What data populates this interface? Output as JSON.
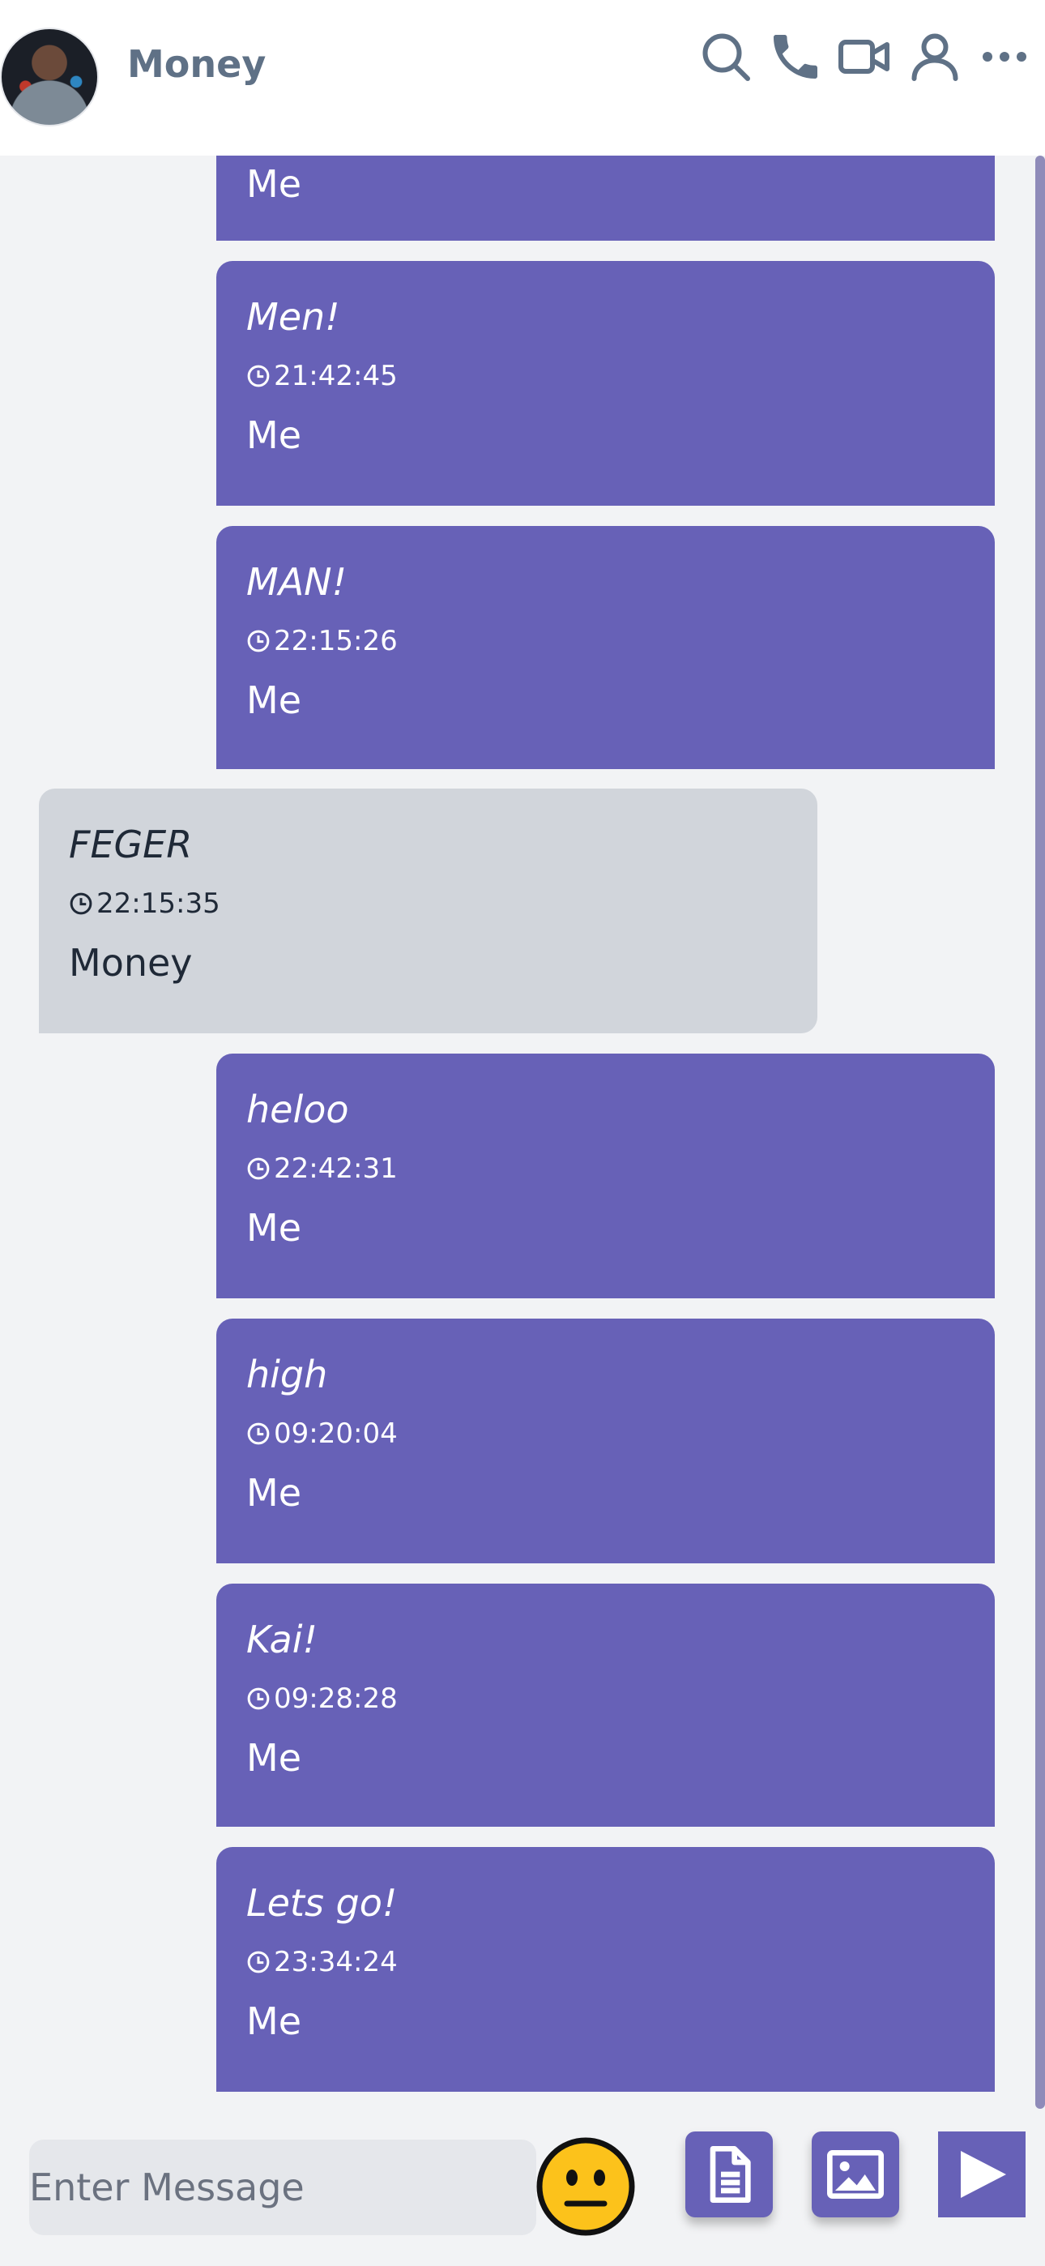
{
  "header": {
    "contact_name": "Money",
    "icons": [
      "search-icon",
      "phone-icon",
      "video-icon",
      "user-icon",
      "more-icon"
    ]
  },
  "messages": [
    {
      "text": "",
      "time": "",
      "sender": "Me",
      "from_me": true
    },
    {
      "text": "Men!",
      "time": "21:42:45",
      "sender": "Me",
      "from_me": true
    },
    {
      "text": "MAN!",
      "time": "22:15:26",
      "sender": "Me",
      "from_me": true
    },
    {
      "text": "FEGER",
      "time": "22:15:35",
      "sender": "Money",
      "from_me": false
    },
    {
      "text": "heloo",
      "time": "22:42:31",
      "sender": "Me",
      "from_me": true
    },
    {
      "text": "high",
      "time": "09:20:04",
      "sender": "Me",
      "from_me": true
    },
    {
      "text": "Kai!",
      "time": "09:28:28",
      "sender": "Me",
      "from_me": true
    },
    {
      "text": "Lets go!",
      "time": "23:34:24",
      "sender": "Me",
      "from_me": true
    }
  ],
  "composer": {
    "placeholder": "Enter Message",
    "buttons": [
      "emoji-icon",
      "document-icon",
      "image-icon",
      "send-icon"
    ]
  },
  "colors": {
    "my_bubble": "#6761b7",
    "their_bubble": "#d1d5db",
    "header_icon": "#5f7186",
    "emoji": "#fcc21b"
  }
}
